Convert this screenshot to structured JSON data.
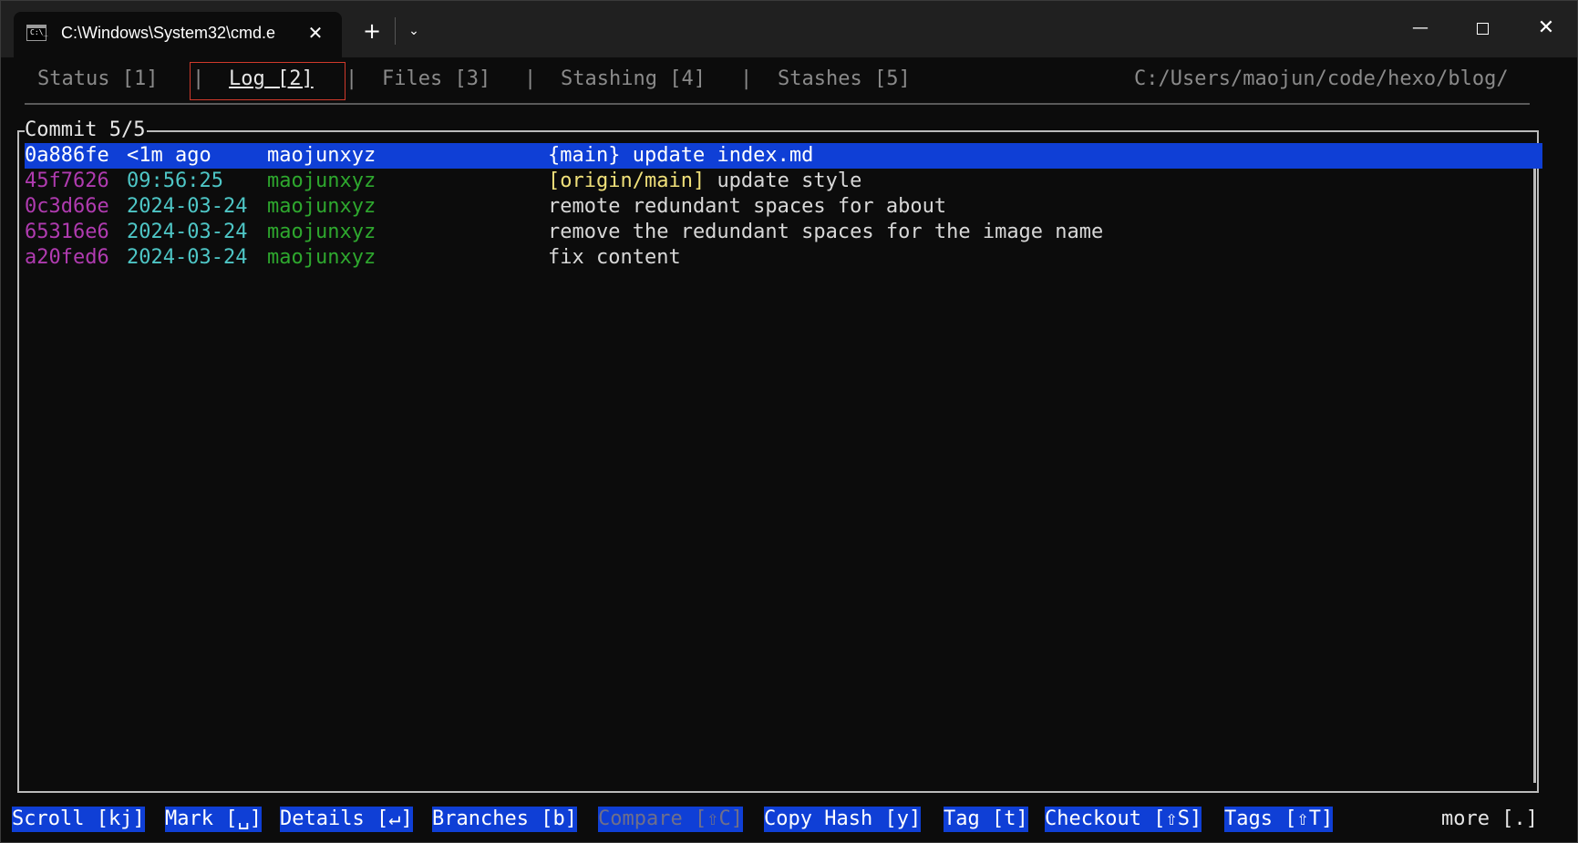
{
  "window": {
    "tab_title": "C:\\Windows\\System32\\cmd.e",
    "tab_icon_text": "C:\\_",
    "close_tab": "✕",
    "new_tab": "+",
    "dropdown": "⌄",
    "minimize": "—",
    "close": "✕"
  },
  "nav": {
    "items": [
      {
        "label": "Status [1]"
      },
      {
        "label": "Log [2]",
        "active": true
      },
      {
        "label": "Files [3]"
      },
      {
        "label": "Stashing [4]"
      },
      {
        "label": "Stashes [5]"
      }
    ],
    "separator": "|",
    "path": "C:/Users/maojun/code/hexo/blog/"
  },
  "commits": {
    "title": "Commit 5/5",
    "rows": [
      {
        "hash": "0a886fe",
        "date": "<1m ago",
        "author": "maojunxyz",
        "ref": "{main}",
        "message": "update index.md",
        "selected": true
      },
      {
        "hash": "45f7626",
        "date": "09:56:25",
        "author": "maojunxyz",
        "ref": "[origin/main]",
        "message": "update style"
      },
      {
        "hash": "0c3d66e",
        "date": "2024-03-24",
        "author": "maojunxyz",
        "ref": "",
        "message": "remote redundant spaces for about"
      },
      {
        "hash": "65316e6",
        "date": "2024-03-24",
        "author": "maojunxyz",
        "ref": "",
        "message": "remove the redundant spaces for the image name"
      },
      {
        "hash": "a20fed6",
        "date": "2024-03-24",
        "author": "maojunxyz",
        "ref": "",
        "message": "fix content"
      }
    ]
  },
  "keybar": {
    "items": [
      {
        "label": "Scroll [kj]"
      },
      {
        "label": "Mark [␣]"
      },
      {
        "label": "Details [↵]"
      },
      {
        "label": "Branches [b]"
      },
      {
        "label": "Compare [⇧C]",
        "disabled": true
      },
      {
        "label": "Copy Hash [y]"
      },
      {
        "label": "Tag [t]"
      },
      {
        "label": "Checkout [⇧S]"
      },
      {
        "label": "Tags [⇧T]"
      }
    ],
    "more": "more [.]"
  },
  "colors": {
    "background": "#0c0c0c",
    "selection": "#0f3fd6",
    "hash": "#b03bb0",
    "date": "#4ec6c6",
    "author": "#2ea82e",
    "ref": "#f0e07a",
    "highlight_box": "#d0392b"
  }
}
